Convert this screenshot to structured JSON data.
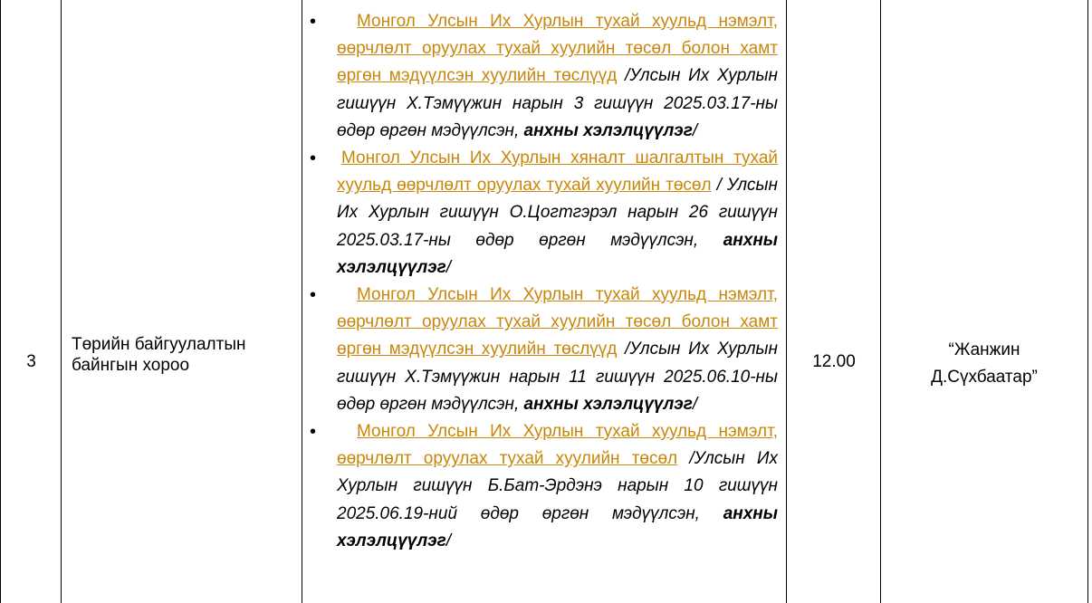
{
  "row": {
    "number": "3",
    "committee": "Төрийн байгуулалтын байнгын хороо",
    "time": "12.00",
    "room": "“Жанжин Д.Сүхбаатар”"
  },
  "bullet_glyph": "•",
  "bills": [
    {
      "title": "Монгол Улсын Их Хурлын тухай хуульд нэмэлт, өөрчлөлт оруулах тухай хуулийн төсөл болон хамт өргөн мэдүүлсэн хуулийн төслүүд",
      "submitter": "/Улсын Их Хурлын гишүүн Х.Тэмүүжин нарын 3 гишүүн 2025.03.17-ны өдөр өргөн мэдүүлсэн,",
      "status": "анхны хэлэлцүүлэг",
      "closing": "/"
    },
    {
      "title": "Монгол Улсын Их Хурлын хяналт шалгалтын тухай хуульд өөрчлөлт оруулах тухай хуулийн төсөл",
      "submitter": "/ Улсын Их Хурлын гишүүн О.Цогтгэрэл нарын 26 гишүүн 2025.03.17-ны өдөр өргөн мэдүүлсэн,",
      "status": "анхны хэлэлцүүлэг",
      "closing": "/"
    },
    {
      "title": "Монгол Улсын Их Хурлын тухай хуульд нэмэлт, өөрчлөлт оруулах тухай хуулийн төсөл болон хамт өргөн мэдүүлсэн хуулийн төслүүд",
      "submitter": "/Улсын Их Хурлын гишүүн Х.Тэмүүжин нарын 11 гишүүн 2025.06.10-ны өдөр өргөн мэдүүлсэн,",
      "status": "анхны хэлэлцүүлэг",
      "closing": "/"
    },
    {
      "title": "Монгол Улсын Их Хурлын тухай хуульд нэмэлт, өөрчлөлт оруулах тухай хуулийн төсөл",
      "submitter": "/Улсын Их Хурлын гишүүн Б.Бат-Эрдэнэ нарын 10 гишүүн 2025.06.19-ний өдөр өргөн мэдүүлсэн,",
      "status": "анхны хэлэлцүүлэг",
      "closing": "/"
    }
  ],
  "colors": {
    "link": "#c8860a",
    "text": "#000000",
    "border": "#000000",
    "background": "#ffffff"
  }
}
